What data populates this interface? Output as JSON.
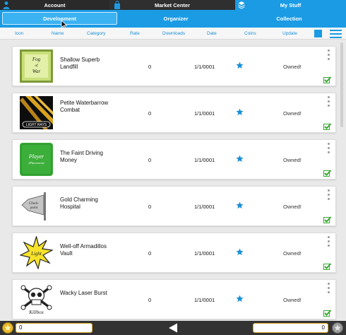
{
  "topbar": {
    "tabs": [
      {
        "label": "Account",
        "icon": "user-icon"
      },
      {
        "label": "Market Center",
        "icon": "bag-icon"
      },
      {
        "label": "My Stuff",
        "icon": "layers-icon"
      }
    ]
  },
  "subtabs": [
    {
      "label": "Development",
      "active": true
    },
    {
      "label": "Organizer"
    },
    {
      "label": "Collection"
    }
  ],
  "columns": [
    "Icon",
    "Name",
    "Category",
    "Rate",
    "Downloads",
    "Date",
    "Coins",
    "Update"
  ],
  "items": [
    {
      "name": "Shallow Superb Landfill",
      "rate": "0",
      "date": "1/1/0001",
      "update": "Owned!",
      "thumb_text": [
        "Fog",
        "of",
        "War"
      ]
    },
    {
      "name": "Petite Waterbarrow Combat",
      "rate": "0",
      "date": "1/1/0001",
      "update": "Owned!",
      "thumb_text": [
        "LIGHT RAYS"
      ]
    },
    {
      "name": "The Faint Driving Money",
      "rate": "0",
      "date": "1/1/0001",
      "update": "Owned!",
      "thumb_text": [
        "Player",
        "(Placement)"
      ]
    },
    {
      "name": "Gold Charming Hospital",
      "rate": "0",
      "date": "1/1/0001",
      "update": "Owned!",
      "thumb_text": [
        "Check-",
        "point"
      ]
    },
    {
      "name": "Well-off Armadillos Vault",
      "rate": "0",
      "date": "1/1/0001",
      "update": "Owned!",
      "thumb_text": [
        "Light"
      ]
    },
    {
      "name": "Wacky Laser Burst",
      "rate": "0",
      "date": "1/1/0001",
      "update": "Owned!",
      "thumb_text": [
        "Killbox"
      ]
    }
  ],
  "bottombar": {
    "left_value": "0",
    "right_value": "0"
  },
  "colors": {
    "accent": "#1b9be4",
    "topbar": "#2a2a2a",
    "owned_check": "#3aa832"
  }
}
